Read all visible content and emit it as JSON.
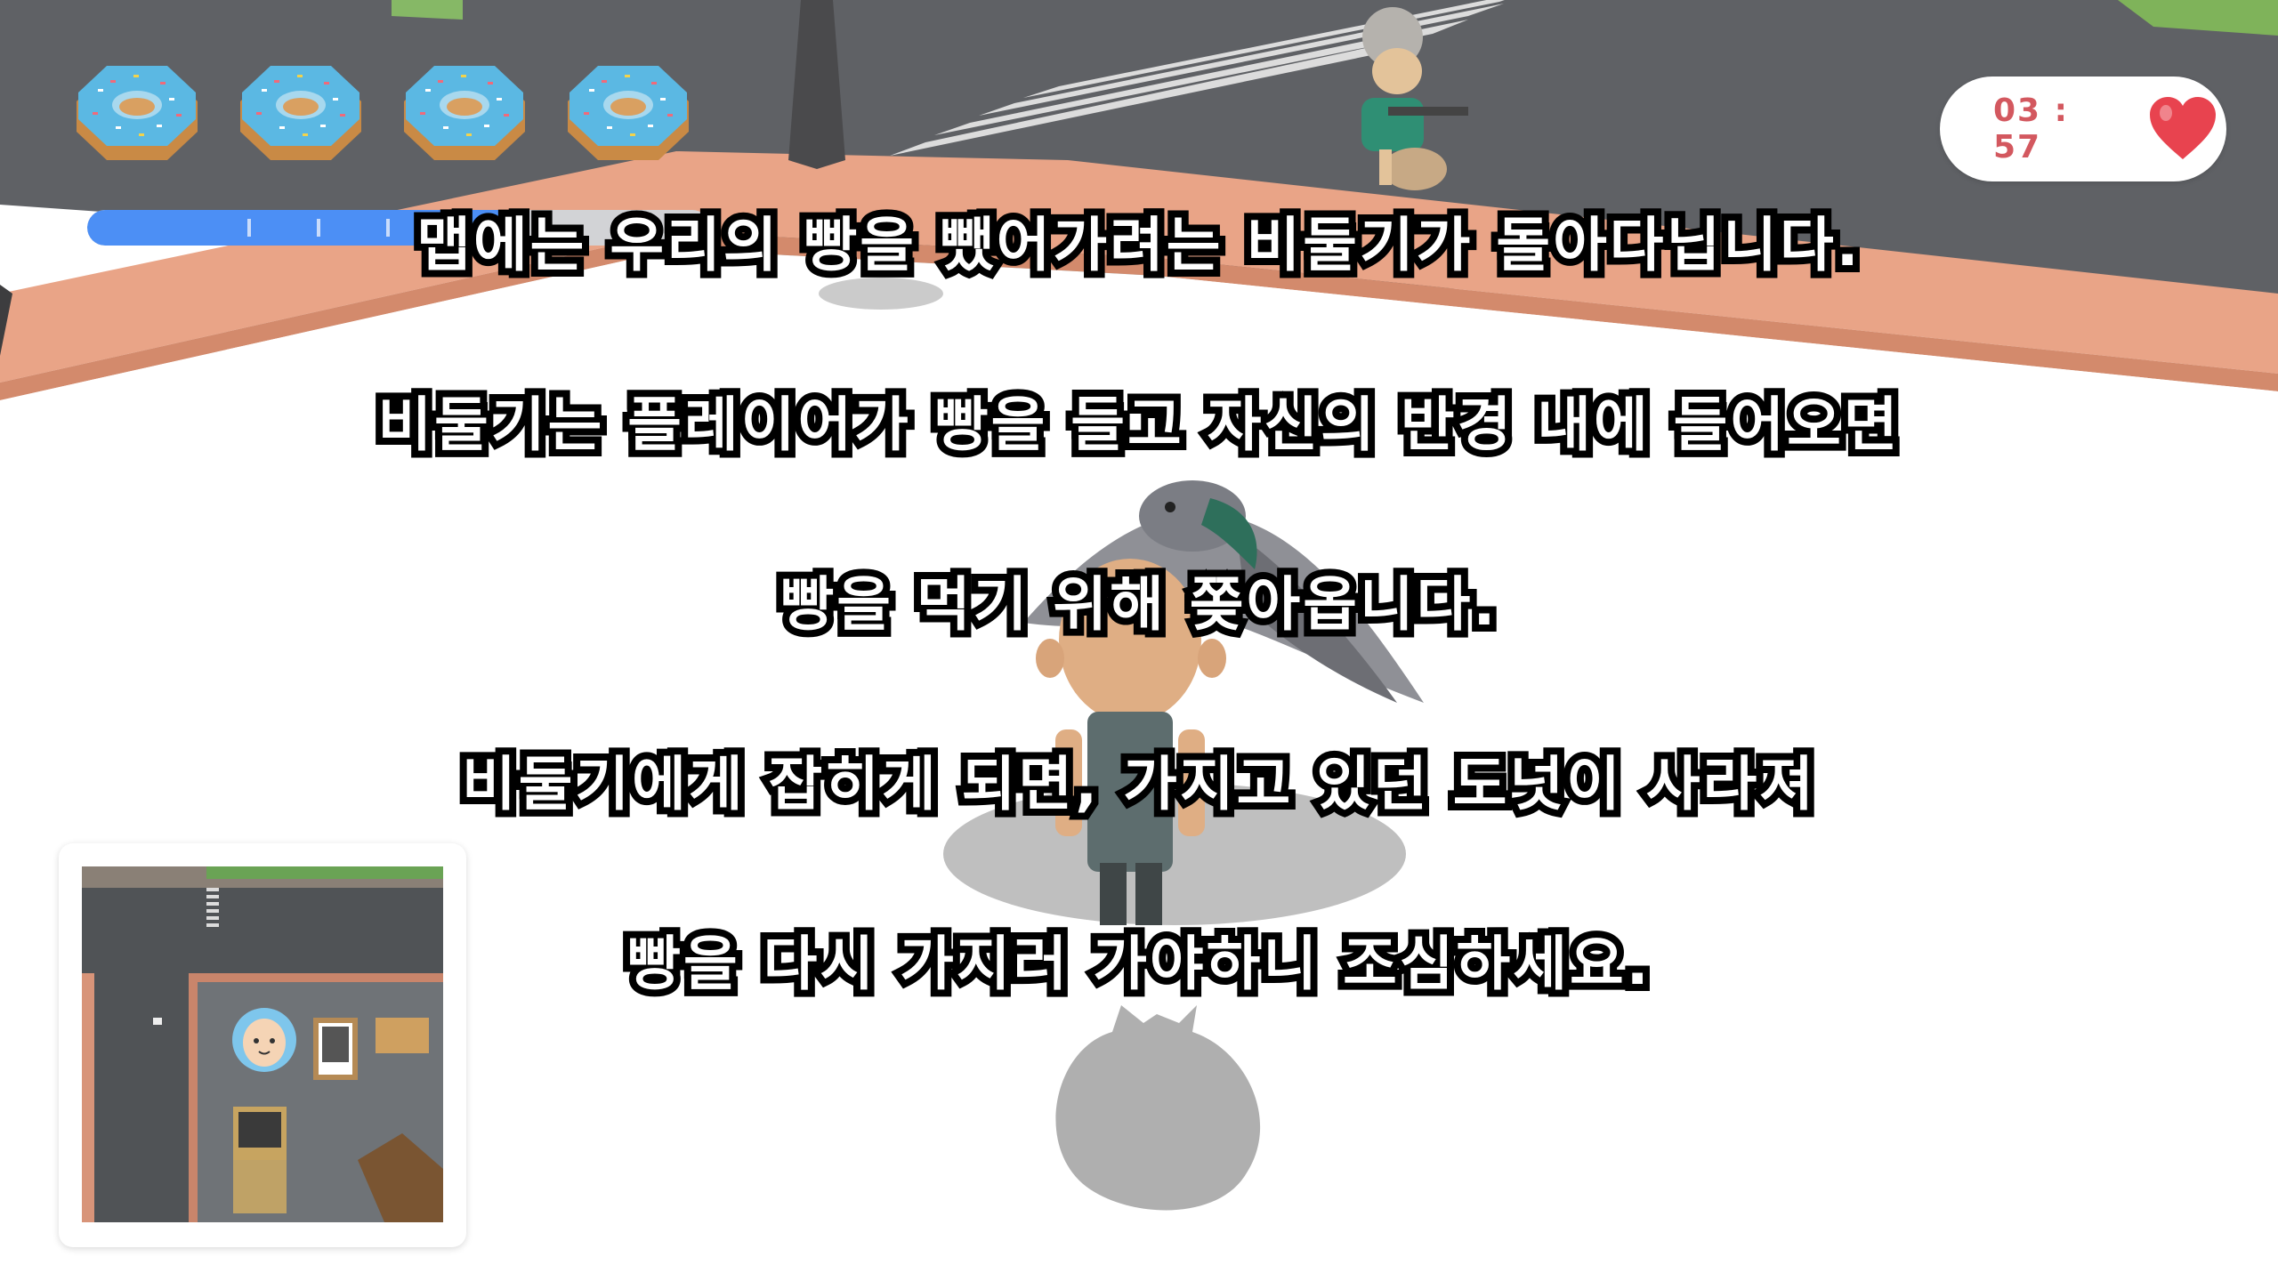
{
  "hud": {
    "lives": {
      "count": 4,
      "icon": "donut-icon"
    },
    "progress": {
      "fraction": 0.71,
      "fill_color": "#4c8ff5"
    },
    "timer": {
      "value": "03 : 57",
      "color": "#d3585f"
    },
    "heart": {
      "icon": "heart-icon",
      "color": "#e8434f"
    }
  },
  "tutorial": {
    "lines": [
      "맵에는 우리의 빵을 뺐어가려는 비둘기가 돌아다닙니다.",
      "비둘기는 플레이어가 빵을 들고 자신의 반경 내에 들어오면",
      "빵을 먹기 위해                 쫒아옵니다.",
      "비둘기에게 잡히게 되면, 가지고 있던 도넛이 사라져",
      "빵을 다시 가지러 가야하니 조심하세요."
    ]
  },
  "minimap": {
    "player_icon": "player-face-icon"
  }
}
